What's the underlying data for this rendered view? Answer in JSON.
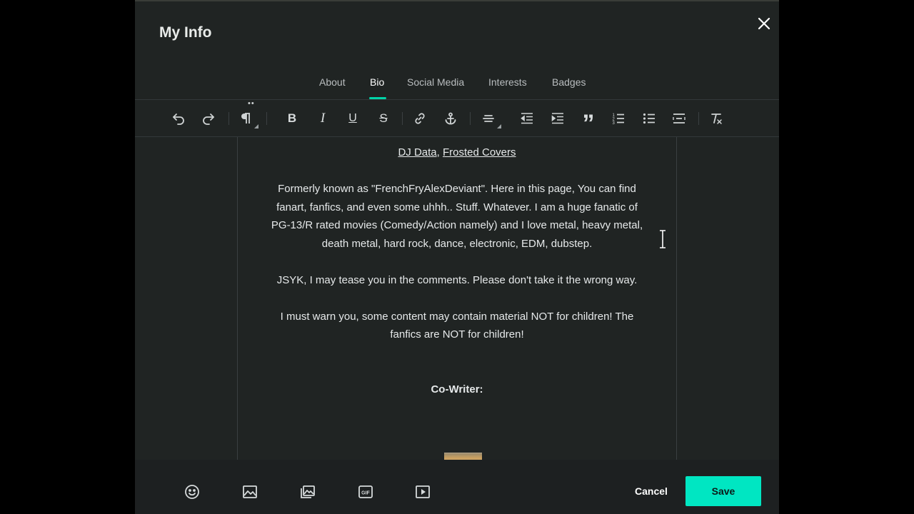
{
  "modal": {
    "title": "My Info"
  },
  "tabs": [
    {
      "label": "About"
    },
    {
      "label": "Bio",
      "active": true
    },
    {
      "label": "Social Media"
    },
    {
      "label": "Interests"
    },
    {
      "label": "Badges"
    }
  ],
  "toolbar": {
    "icons": [
      "undo-icon",
      "redo-icon",
      "paragraph-icon",
      "bold-icon",
      "italic-icon",
      "underline-icon",
      "strikethrough-icon",
      "link-icon",
      "anchor-icon",
      "align-icon",
      "outdent-icon",
      "indent-icon",
      "blockquote-icon",
      "ordered-list-icon",
      "unordered-list-icon",
      "align-center-icon",
      "clear-format-icon"
    ],
    "bold_glyph": "B",
    "italic_glyph": "I",
    "underline_glyph": "U",
    "strike_glyph": "S",
    "quote_glyph": "”"
  },
  "bio": {
    "link1": "DJ Data",
    "separator": ",",
    "link2": "Frosted Covers",
    "para1": "Formerly known as \"FrenchFryAlexDeviant\". Here in this page, You can find fanart, fanfics, and even some uhhh.. Stuff. Whatever. I am a huge fanatic of PG-13/R rated movies (Comedy/Action namely) and I love metal, heavy metal, death metal, hard rock, dance, electronic, EDM, dubstep.",
    "para2": "JSYK, I may tease you in the comments. Please don't take it the wrong way.",
    "para3": "I must warn you, some content may contain material NOT for children! The fanfics are NOT for children!",
    "cowriter_label": "Co-Writer:"
  },
  "bottom": {
    "icons": [
      "emoji-icon",
      "image-icon",
      "gallery-icon",
      "gif-icon",
      "video-icon"
    ],
    "gif_label": "GIF",
    "cancel": "Cancel",
    "save": "Save"
  },
  "colors": {
    "accent": "#00d4a8",
    "save_bg": "#00e6c2",
    "modal_bg": "#202423"
  }
}
